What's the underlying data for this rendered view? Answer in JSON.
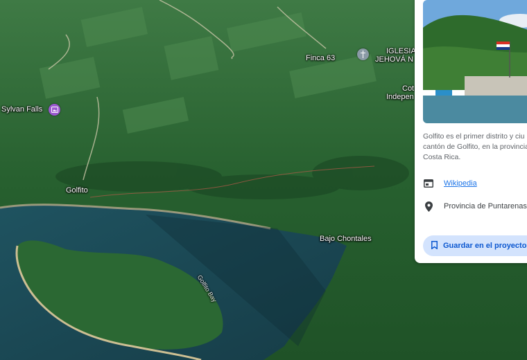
{
  "map": {
    "places": {
      "finca": "Finca 63",
      "iglesia_line1": "IGLESIA",
      "iglesia_line2": "JEHOVÁ N",
      "coto_line1": "Cot",
      "coto_line2": "Indepen",
      "sylvan": "Sylvan Falls",
      "golfito": "Golfito",
      "bajo": "Bajo Chontales",
      "bay": "Golfito Bay"
    },
    "icons": {
      "church": "church-icon",
      "waterfall": "photo-pin-icon"
    },
    "colors": {
      "forest": "#2f6b3a",
      "water": "#1d4d5c",
      "pin_purple": "#9b59d0",
      "pin_gray": "#8a9aa6"
    }
  },
  "panel": {
    "description": "Golfito es el primer distrito y ciu cantón de Golfito, en la provincia de Costa Rica.",
    "wikipedia": "Wikipedia",
    "address": "Provincia de Puntarenas, C",
    "save_label": "Guardar en el proyecto",
    "accent": "#0b57d0"
  }
}
